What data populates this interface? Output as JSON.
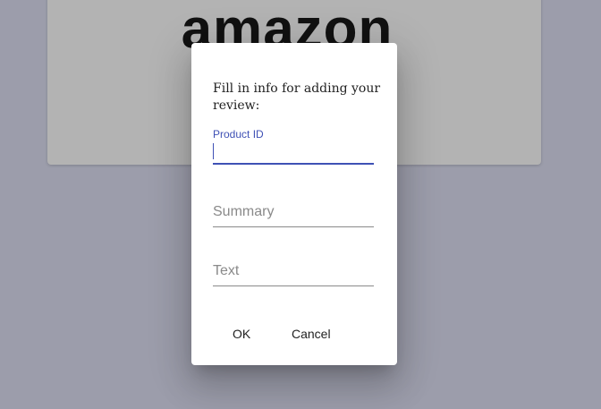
{
  "background": {
    "logo_text": "amazon",
    "colors": {
      "backdrop": "#9c9dab",
      "card": "#b3b3b3"
    }
  },
  "dialog": {
    "title": "Fill in info for adding your review:",
    "fields": {
      "product_id": {
        "label": "Product ID",
        "value": "",
        "focused": true
      },
      "summary": {
        "placeholder": "Summary",
        "value": ""
      },
      "text": {
        "placeholder": "Text",
        "value": ""
      }
    },
    "actions": {
      "ok_label": "OK",
      "cancel_label": "Cancel"
    },
    "colors": {
      "accent": "#3f51b5",
      "surface": "#ffffff"
    }
  }
}
